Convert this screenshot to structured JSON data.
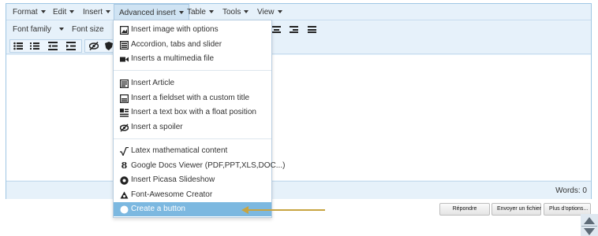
{
  "menubar": {
    "items": [
      {
        "label": "Format"
      },
      {
        "label": "Edit"
      },
      {
        "label": "Insert"
      },
      {
        "label": "Advanced insert"
      },
      {
        "label": "Table"
      },
      {
        "label": "Tools"
      },
      {
        "label": "View"
      }
    ],
    "active": "Advanced insert"
  },
  "toolbar": {
    "font_family": "Font family",
    "font_size": "Font size"
  },
  "dropdown": {
    "items": [
      {
        "label": "Insert image with options",
        "icon": "image-icon"
      },
      {
        "label": "Accordion, tabs and slider",
        "icon": "accordion-icon"
      },
      {
        "label": "Inserts a multimedia file",
        "icon": "video-icon"
      },
      {
        "label": "Insert Article",
        "icon": "article-icon"
      },
      {
        "label": "Insert a fieldset with a custom title",
        "icon": "fieldset-icon"
      },
      {
        "label": "Insert a text box with a float position",
        "icon": "textbox-icon"
      },
      {
        "label": "Insert a spoiler",
        "icon": "spoiler-icon"
      },
      {
        "label": "Latex mathematical content",
        "icon": "sqrt-icon"
      },
      {
        "label": "Google Docs Viewer (PDF,PPT,XLS,DOC...)",
        "icon": "google-icon"
      },
      {
        "label": "Insert Picasa Slideshow",
        "icon": "picasa-icon"
      },
      {
        "label": "Font-Awesome Creator",
        "icon": "flag-icon"
      },
      {
        "label": "Create a button",
        "icon": "button-icon"
      }
    ],
    "highlighted": "Create a button"
  },
  "statusbar": {
    "words": "Words: 0"
  },
  "actions": {
    "reply": "Répondre",
    "upload": "Envoyer un fichier",
    "more": "Plus d'options..."
  },
  "colors": {
    "accent": "#7cb8e0",
    "annotation_arrow": "#c8a441",
    "border": "#9fc6e4"
  }
}
